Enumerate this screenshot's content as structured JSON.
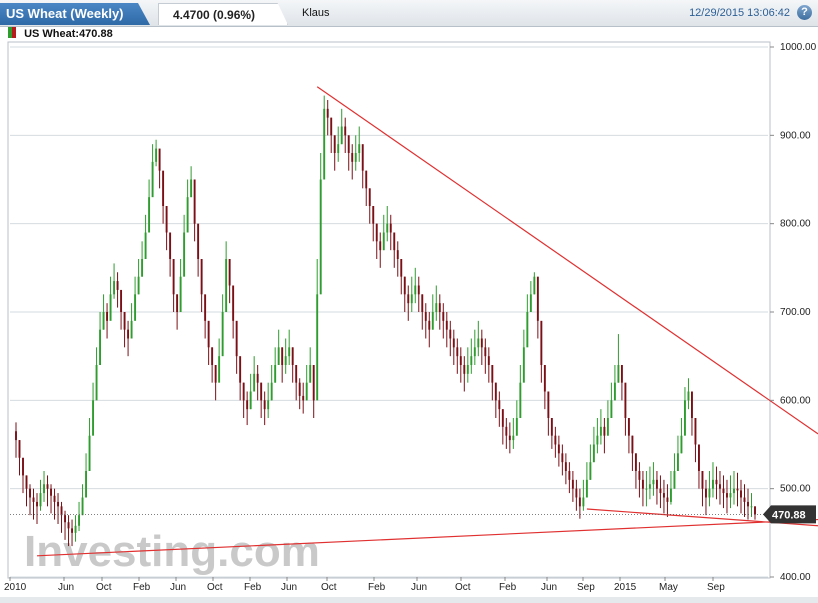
{
  "header": {
    "title": "US Wheat (Weekly)",
    "price_change": "4.4700 (0.96%)",
    "user": "Klaus",
    "datetime": "12/29/2015 13:06:42",
    "help_icon": "help-icon"
  },
  "legend": {
    "label": "US Wheat:470.88"
  },
  "watermark": "Investing.com",
  "colors": {
    "up": "#2e9c2e",
    "down": "#7a0f16",
    "trendline": "#e03030",
    "accent": "#3b78b8"
  },
  "chart_data": {
    "type": "candlestick",
    "title": "US Wheat (Weekly)",
    "last_value": 470.88,
    "last_value_label": "470.88",
    "ylim": [
      400,
      1000
    ],
    "y_ticks": [
      1000,
      900,
      800,
      700,
      600,
      500,
      400
    ],
    "y_tick_labels": [
      "1000.00",
      "900.00",
      "800.00",
      "700.00",
      "600.00",
      "500.00",
      "400.00"
    ],
    "x_tick_labels": [
      "2010",
      "Jun",
      "Oct",
      "Feb",
      "Jun",
      "Oct",
      "Feb",
      "Jun",
      "Oct",
      "Feb",
      "Jun",
      "Oct",
      "Feb",
      "Jun",
      "Sep",
      "2015",
      "May",
      "Sep"
    ],
    "grid": true,
    "weekly_closes": [
      555,
      535,
      515,
      500,
      490,
      485,
      480,
      495,
      505,
      500,
      492,
      485,
      480,
      470,
      462,
      455,
      450,
      458,
      470,
      490,
      520,
      560,
      600,
      640,
      680,
      700,
      690,
      720,
      735,
      725,
      700,
      680,
      670,
      690,
      720,
      740,
      760,
      790,
      830,
      870,
      885,
      860,
      820,
      790,
      760,
      720,
      700,
      740,
      790,
      830,
      850,
      800,
      760,
      720,
      690,
      660,
      640,
      620,
      650,
      700,
      760,
      730,
      690,
      650,
      620,
      600,
      590,
      610,
      630,
      620,
      600,
      590,
      600,
      620,
      640,
      660,
      640,
      650,
      660,
      640,
      620,
      605,
      600,
      620,
      640,
      600,
      720,
      850,
      930,
      920,
      900,
      880,
      890,
      910,
      900,
      880,
      870,
      880,
      890,
      860,
      840,
      820,
      800,
      780,
      770,
      790,
      800,
      790,
      770,
      760,
      740,
      720,
      710,
      720,
      730,
      720,
      700,
      690,
      680,
      700,
      710,
      700,
      690,
      680,
      670,
      660,
      650,
      640,
      630,
      640,
      650,
      660,
      670,
      660,
      650,
      640,
      620,
      600,
      590,
      570,
      560,
      555,
      560,
      580,
      620,
      660,
      700,
      720,
      740,
      690,
      640,
      610,
      580,
      560,
      550,
      540,
      530,
      520,
      510,
      500,
      490,
      480,
      490,
      510,
      530,
      550,
      560,
      570,
      560,
      580,
      600,
      620,
      640,
      620,
      580,
      560,
      540,
      520,
      510,
      500,
      500,
      505,
      510,
      500,
      495,
      490,
      485,
      500,
      520,
      540,
      560,
      600,
      610,
      580,
      550,
      520,
      500,
      490,
      500,
      510,
      505,
      500,
      495,
      490,
      495,
      500,
      498,
      490,
      485,
      480,
      480,
      470.88
    ],
    "weekly_highs": [
      575,
      555,
      530,
      515,
      505,
      500,
      495,
      510,
      520,
      515,
      505,
      500,
      495,
      485,
      475,
      470,
      465,
      470,
      485,
      505,
      540,
      580,
      620,
      660,
      700,
      720,
      710,
      740,
      755,
      745,
      720,
      700,
      690,
      710,
      740,
      760,
      780,
      810,
      850,
      890,
      895,
      880,
      840,
      810,
      780,
      740,
      720,
      760,
      810,
      850,
      865,
      820,
      780,
      740,
      710,
      680,
      660,
      640,
      670,
      720,
      780,
      750,
      710,
      670,
      640,
      620,
      610,
      630,
      650,
      640,
      620,
      610,
      620,
      640,
      660,
      680,
      660,
      670,
      680,
      660,
      640,
      625,
      620,
      640,
      660,
      620,
      760,
      880,
      945,
      940,
      920,
      900,
      910,
      930,
      920,
      900,
      890,
      900,
      910,
      880,
      860,
      840,
      820,
      800,
      790,
      810,
      820,
      810,
      790,
      780,
      760,
      740,
      730,
      740,
      750,
      740,
      720,
      710,
      700,
      720,
      730,
      720,
      710,
      700,
      690,
      680,
      670,
      660,
      650,
      660,
      670,
      680,
      690,
      680,
      670,
      660,
      640,
      620,
      610,
      590,
      580,
      575,
      580,
      600,
      640,
      680,
      720,
      735,
      745,
      710,
      660,
      630,
      600,
      580,
      570,
      560,
      550,
      540,
      530,
      520,
      510,
      500,
      510,
      530,
      550,
      570,
      580,
      590,
      580,
      600,
      620,
      640,
      675,
      640,
      600,
      580,
      560,
      540,
      530,
      520,
      520,
      525,
      530,
      520,
      515,
      510,
      505,
      520,
      540,
      560,
      580,
      615,
      625,
      600,
      570,
      540,
      520,
      510,
      520,
      530,
      525,
      520,
      515,
      510,
      515,
      520,
      518,
      510,
      505,
      500,
      495,
      480
    ],
    "weekly_lows": [
      535,
      515,
      495,
      480,
      470,
      465,
      460,
      475,
      485,
      480,
      472,
      465,
      460,
      450,
      442,
      435,
      435,
      440,
      452,
      470,
      500,
      540,
      580,
      620,
      660,
      680,
      670,
      700,
      715,
      705,
      680,
      660,
      650,
      670,
      700,
      720,
      740,
      770,
      810,
      850,
      865,
      840,
      800,
      770,
      740,
      700,
      680,
      720,
      770,
      810,
      830,
      780,
      740,
      700,
      670,
      640,
      620,
      600,
      630,
      680,
      740,
      710,
      670,
      630,
      600,
      580,
      572,
      590,
      610,
      600,
      580,
      572,
      580,
      600,
      620,
      640,
      620,
      630,
      640,
      620,
      600,
      590,
      585,
      600,
      620,
      580,
      700,
      830,
      910,
      900,
      880,
      860,
      870,
      890,
      880,
      860,
      850,
      860,
      870,
      840,
      820,
      800,
      780,
      760,
      750,
      770,
      780,
      770,
      750,
      740,
      720,
      700,
      690,
      700,
      710,
      700,
      680,
      670,
      660,
      680,
      690,
      680,
      670,
      660,
      650,
      640,
      630,
      620,
      610,
      620,
      630,
      640,
      650,
      640,
      630,
      620,
      600,
      580,
      570,
      550,
      545,
      540,
      545,
      560,
      600,
      640,
      680,
      700,
      720,
      670,
      620,
      590,
      560,
      545,
      535,
      525,
      515,
      505,
      495,
      485,
      475,
      466,
      475,
      490,
      510,
      530,
      540,
      550,
      540,
      560,
      580,
      600,
      620,
      600,
      560,
      540,
      520,
      500,
      490,
      480,
      480,
      488,
      492,
      482,
      478,
      472,
      468,
      482,
      500,
      520,
      540,
      580,
      590,
      560,
      530,
      500,
      480,
      470,
      480,
      490,
      488,
      482,
      478,
      472,
      478,
      482,
      480,
      472,
      468,
      465,
      468,
      465
    ],
    "trendlines": [
      {
        "from": {
          "week": 86,
          "value": 955
        },
        "to": {
          "week": 229,
          "value": 562
        }
      },
      {
        "from": {
          "week": 6,
          "value": 424
        },
        "to": {
          "week": 229,
          "value": 465
        }
      },
      {
        "from": {
          "week": 163,
          "value": 477
        },
        "to": {
          "week": 229,
          "value": 458
        }
      }
    ]
  }
}
